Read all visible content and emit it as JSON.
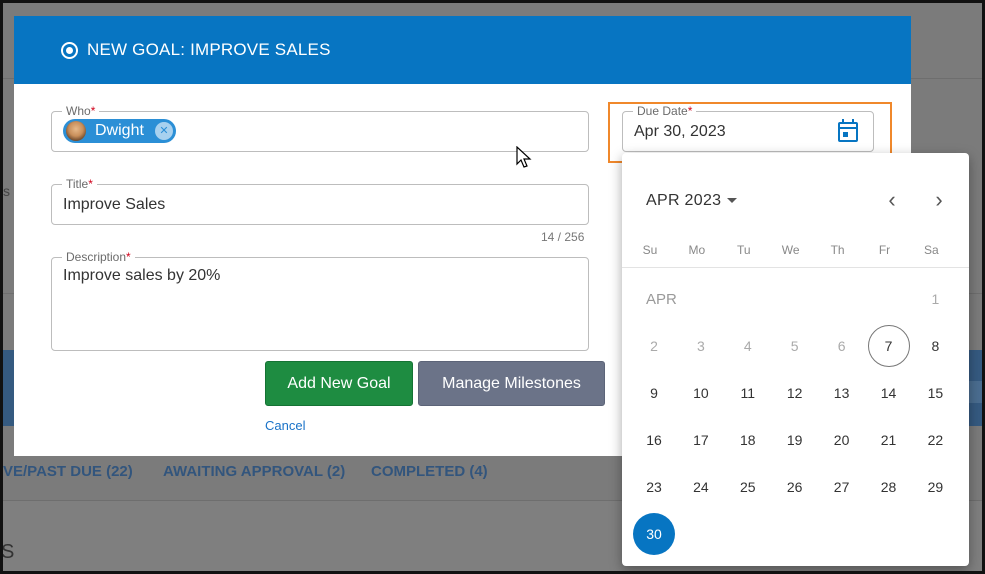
{
  "modal": {
    "title": "NEW GOAL: IMPROVE SALES",
    "who": {
      "label": "Who",
      "required_mark": "*",
      "chip_name": "Dwight"
    },
    "title_field": {
      "label": "Title",
      "required_mark": "*",
      "value": "Improve Sales",
      "counter": "14 / 256"
    },
    "description": {
      "label": "Description",
      "required_mark": "*",
      "value": "Improve sales by 20%"
    },
    "due_date": {
      "label": "Due Date",
      "required_mark": "*",
      "value": "Apr 30, 2023"
    },
    "buttons": {
      "add_goal": "Add New Goal",
      "manage_milestones": "Manage Milestones",
      "cancel": "Cancel"
    }
  },
  "background": {
    "tabs": [
      "VE/PAST DUE (22)",
      "AWAITING APPROVAL (2)",
      "COMPLETED (4)"
    ],
    "fragment_s": "S"
  },
  "datepicker": {
    "month_year": "APR 2023",
    "month_label": "APR",
    "weekdays": [
      "Su",
      "Mo",
      "Tu",
      "We",
      "Th",
      "Fr",
      "Sa"
    ],
    "today": 7,
    "selected": 30,
    "days": [
      1,
      2,
      3,
      4,
      5,
      6,
      7,
      8,
      9,
      10,
      11,
      12,
      13,
      14,
      15,
      16,
      17,
      18,
      19,
      20,
      21,
      22,
      23,
      24,
      25,
      26,
      27,
      28,
      29,
      30
    ]
  },
  "colors": {
    "header_blue": "#0775c2",
    "primary_green": "#1e8c41",
    "secondary_gray": "#6b7388",
    "highlight_orange": "#f0882b"
  }
}
